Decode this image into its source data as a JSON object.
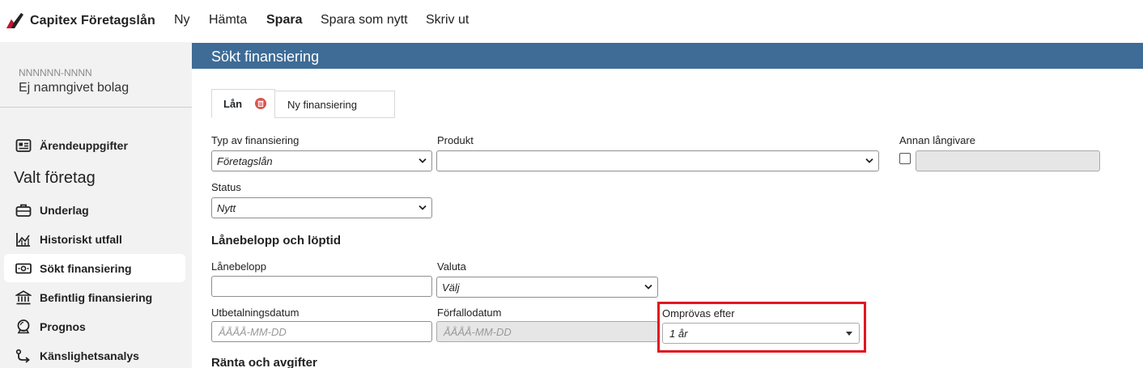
{
  "topbar": {
    "brand": "Capitex Företagslån",
    "nav": [
      "Ny",
      "Hämta",
      "Spara",
      "Spara som nytt",
      "Skriv ut"
    ]
  },
  "sidebar": {
    "company_id": "NNNNNN-NNNN",
    "company_name": "Ej namngivet bolag",
    "case_item": "Ärendeuppgifter",
    "heading": "Valt företag",
    "items": [
      {
        "label": "Underlag",
        "icon": "briefcase-icon"
      },
      {
        "label": "Historiskt utfall",
        "icon": "chart-icon"
      },
      {
        "label": "Sökt finansiering",
        "icon": "money-icon"
      },
      {
        "label": "Befintlig finansiering",
        "icon": "bank-icon"
      },
      {
        "label": "Prognos",
        "icon": "crystal-ball-icon"
      },
      {
        "label": "Känslighetsanalys",
        "icon": "route-icon"
      }
    ],
    "active_item": "Sökt finansiering"
  },
  "main": {
    "section_title": "Sökt finansiering",
    "tabs": {
      "active": "Lån",
      "new": "Ny finansiering"
    },
    "fields": {
      "type_label": "Typ av finansiering",
      "type_value": "Företagslån",
      "product_label": "Produkt",
      "product_value": "",
      "other_lender_label": "Annan långivare",
      "status_label": "Status",
      "status_value": "Nytt",
      "loan_section": "Lånebelopp och löptid",
      "amount_label": "Lånebelopp",
      "currency_label": "Valuta",
      "currency_value": "Välj",
      "payout_label": "Utbetalningsdatum",
      "payout_placeholder": "ÅÅÅÅ-MM-DD",
      "maturity_label": "Förfallodatum",
      "maturity_placeholder": "ÅÅÅÅ-MM-DD",
      "review_label": "Omprövas efter",
      "review_value": "1 år",
      "interest_section": "Ränta och avgifter"
    }
  },
  "colors": {
    "header_blue": "#3e6c97",
    "highlight_red": "#e0171f",
    "logo_red": "#c8102e"
  }
}
